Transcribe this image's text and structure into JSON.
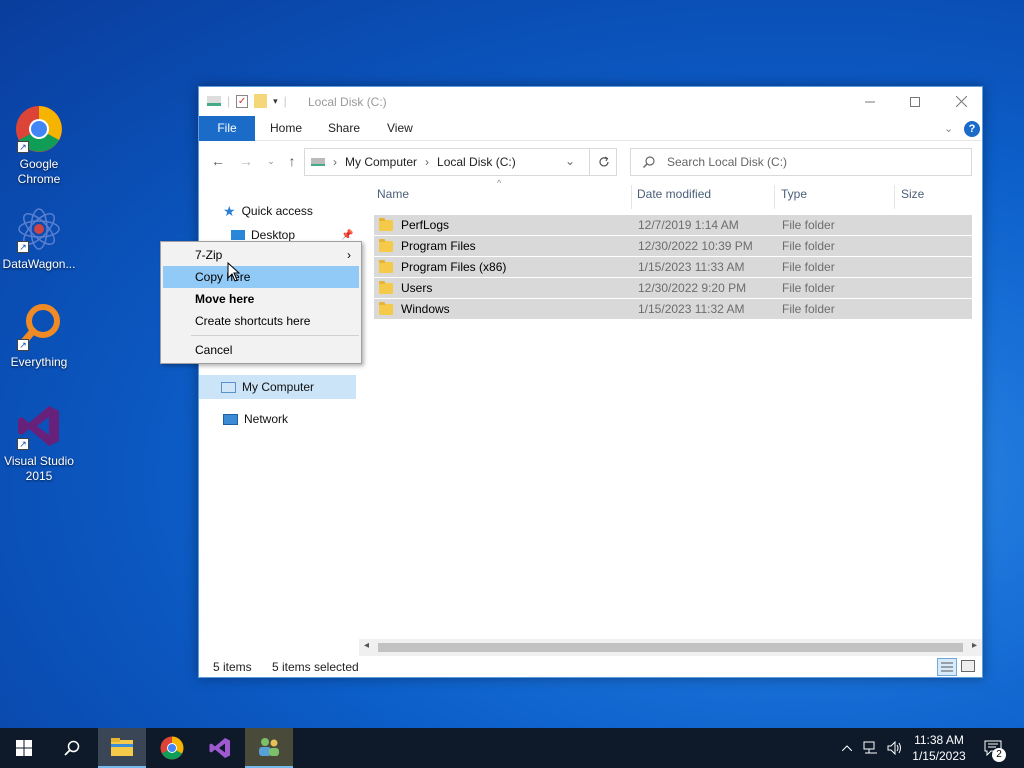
{
  "desktop": {
    "icons": [
      {
        "label": "Google Chrome"
      },
      {
        "label": "DataWagon..."
      },
      {
        "label": "Everything"
      },
      {
        "label": "Visual Studio 2015"
      }
    ]
  },
  "window": {
    "title": "Local Disk (C:)",
    "ribbon_tabs": [
      "File",
      "Home",
      "Share",
      "View"
    ],
    "breadcrumb": [
      "My Computer",
      "Local Disk (C:)"
    ],
    "search_placeholder": "Search Local Disk (C:)",
    "nav_pane": {
      "quick_access": "Quick access",
      "desktop": "Desktop",
      "my_computer": "My Computer",
      "network": "Network"
    },
    "columns": [
      "Name",
      "Date modified",
      "Type",
      "Size"
    ],
    "files": [
      {
        "name": "PerfLogs",
        "date": "12/7/2019 1:14 AM",
        "type": "File folder"
      },
      {
        "name": "Program Files",
        "date": "12/30/2022 10:39 PM",
        "type": "File folder"
      },
      {
        "name": "Program Files (x86)",
        "date": "1/15/2023 11:33 AM",
        "type": "File folder"
      },
      {
        "name": "Users",
        "date": "12/30/2022 9:20 PM",
        "type": "File folder"
      },
      {
        "name": "Windows",
        "date": "1/15/2023 11:32 AM",
        "type": "File folder"
      }
    ],
    "status": {
      "count": "5 items",
      "selected": "5 items selected"
    }
  },
  "context_menu": {
    "items": [
      {
        "label": "7-Zip",
        "has_submenu": true
      },
      {
        "label": "Copy here",
        "highlighted": true
      },
      {
        "label": "Move here",
        "bold": true
      },
      {
        "label": "Create shortcuts here"
      },
      {
        "label": "Cancel"
      }
    ]
  },
  "taskbar": {
    "time": "11:38 AM",
    "date": "1/15/2023",
    "notification_count": "2"
  },
  "colors": {
    "accent": "#1a6cc8",
    "selection": "#d9d9d9",
    "menu_highlight": "#91c9f7"
  }
}
